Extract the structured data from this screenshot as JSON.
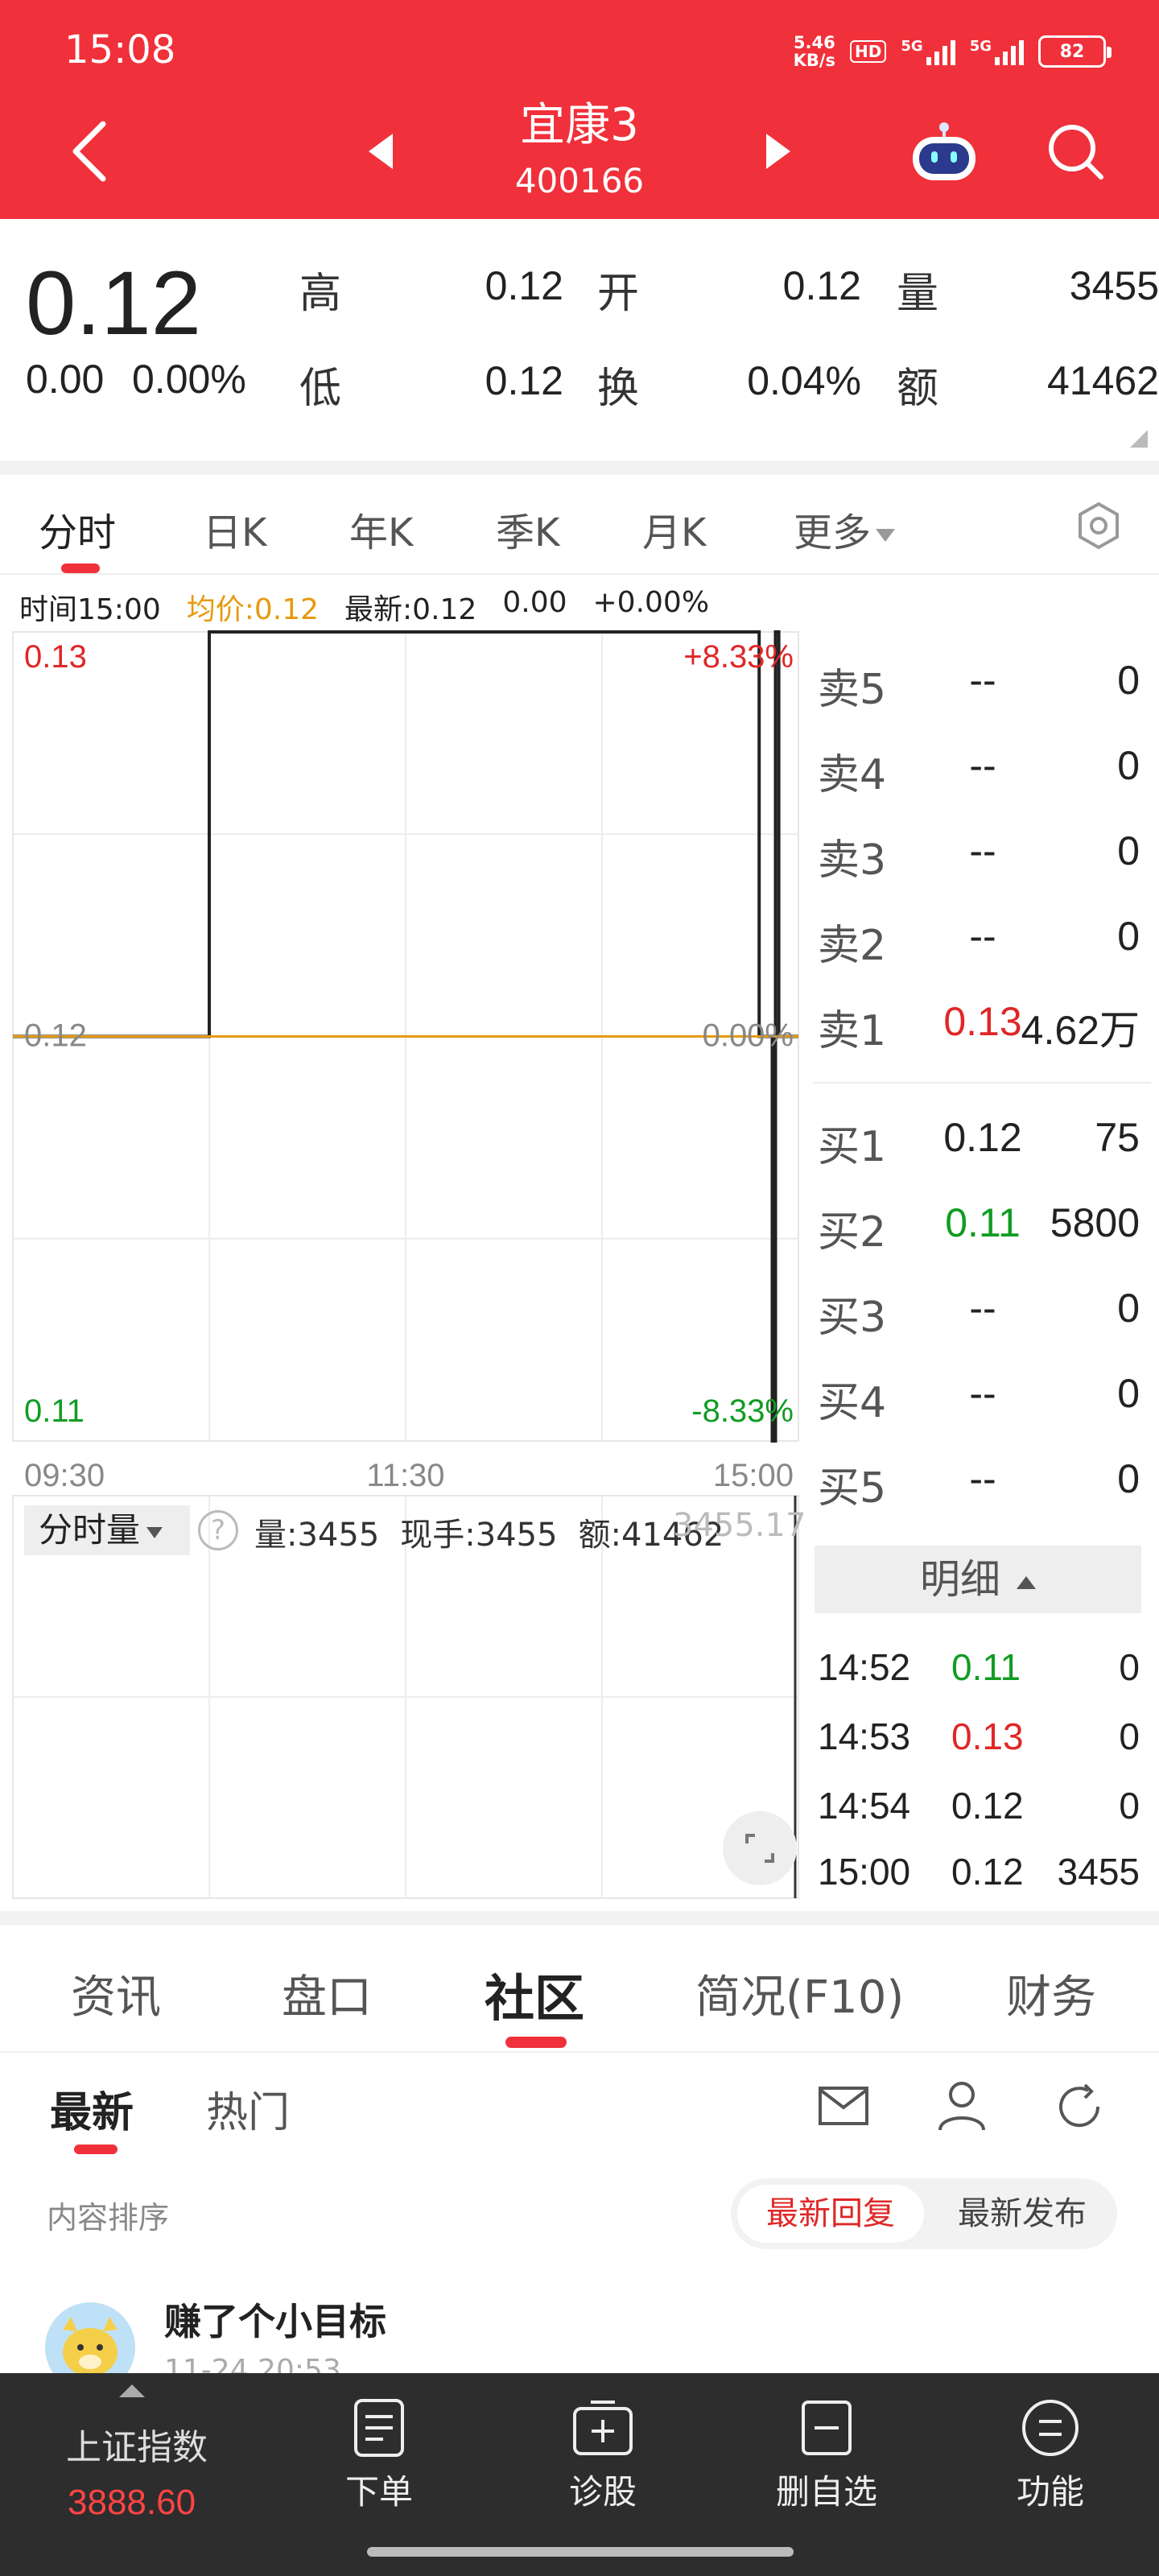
{
  "status": {
    "time": "15:08",
    "speed_top": "5.46",
    "speed_bottom": "KB/s",
    "hd": "HD",
    "net1": "5G",
    "net2": "5G",
    "battery": "82"
  },
  "header": {
    "name": "宜康3",
    "code": "400166"
  },
  "quote": {
    "price": "0.12",
    "change": "0.00",
    "change_pct": "0.00%",
    "fields": [
      {
        "label": "高",
        "value": "0.12"
      },
      {
        "label": "开",
        "value": "0.12"
      },
      {
        "label": "量",
        "value": "3455"
      },
      {
        "label": "低",
        "value": "0.12"
      },
      {
        "label": "换",
        "value": "0.04%"
      },
      {
        "label": "额",
        "value": "41462"
      }
    ]
  },
  "ktabs": [
    "分时",
    "日K",
    "年K",
    "季K",
    "月K",
    "更多"
  ],
  "chartinfo": {
    "time": "时间15:00",
    "avg": "均价:0.12",
    "latest": "最新:0.12",
    "chg": "0.00",
    "pct": "+0.00%"
  },
  "chart_data": {
    "type": "line",
    "title": "",
    "x_ticks": [
      "09:30",
      "11:30",
      "15:00"
    ],
    "y_ticks_left": [
      "0.13",
      "0.12",
      "0.11"
    ],
    "y_ticks_right": [
      "+8.33%",
      "0.00%",
      "-8.33%"
    ],
    "ylim": [
      0.11,
      0.13
    ],
    "series": [
      {
        "name": "",
        "color": "#222222",
        "x": [
          "09:30",
          "10:30",
          "10:30",
          "14:48",
          "14:48",
          "14:52",
          "14:52",
          "14:53",
          "14:53",
          "14:54",
          "14:54",
          "15:00"
        ],
        "values": [
          0.12,
          0.12,
          0.13,
          0.13,
          0.12,
          0.12,
          0.11,
          0.11,
          0.13,
          0.13,
          0.12,
          0.12
        ]
      },
      {
        "name": "均价",
        "color": "#e79a10",
        "x": [
          "09:30",
          "15:00"
        ],
        "values": [
          0.12,
          0.12
        ]
      }
    ]
  },
  "orderbook": {
    "sell": [
      {
        "label": "卖5",
        "price": "--",
        "vol": "0"
      },
      {
        "label": "卖4",
        "price": "--",
        "vol": "0"
      },
      {
        "label": "卖3",
        "price": "--",
        "vol": "0"
      },
      {
        "label": "卖2",
        "price": "--",
        "vol": "0"
      },
      {
        "label": "卖1",
        "price": "0.13",
        "vol": "4.62万"
      }
    ],
    "buy": [
      {
        "label": "买1",
        "price": "0.12",
        "vol": "75"
      },
      {
        "label": "买2",
        "price": "0.11",
        "vol": "5800"
      },
      {
        "label": "买3",
        "price": "--",
        "vol": "0"
      },
      {
        "label": "买4",
        "price": "--",
        "vol": "0"
      },
      {
        "label": "买5",
        "price": "--",
        "vol": "0"
      }
    ]
  },
  "mingxi": {
    "label": "明细"
  },
  "trades": [
    {
      "time": "14:52",
      "price": "0.11",
      "vol": "0"
    },
    {
      "time": "14:53",
      "price": "0.13",
      "vol": "0"
    },
    {
      "time": "14:54",
      "price": "0.12",
      "vol": "0"
    },
    {
      "time": "15:00",
      "price": "0.12",
      "vol": "3455"
    }
  ],
  "volume": {
    "dropdown": "分时量",
    "help": "?",
    "vol": "量:3455",
    "hand": "现手:3455",
    "amount": "额:41462",
    "top_value": "3455.17"
  },
  "btabs": [
    "资讯",
    "盘口",
    "社区",
    "简况(F10)",
    "财务"
  ],
  "subtabs": [
    "最新",
    "热门"
  ],
  "sort": {
    "label": "内容排序",
    "opt1": "最新回复",
    "opt2": "最新发布"
  },
  "post": {
    "title": "赚了个小目标",
    "time": "11-24 20:53"
  },
  "bottombar": {
    "index_name": "上证指数",
    "index_value": "3888.60",
    "items": [
      "下单",
      "诊股",
      "删自选",
      "功能"
    ]
  }
}
